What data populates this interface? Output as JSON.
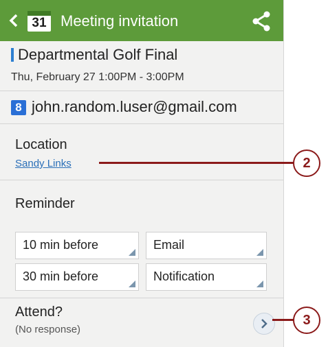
{
  "app_bar": {
    "calendar_day": "31",
    "title": "Meeting invitation"
  },
  "event": {
    "title": "Departmental Golf Final",
    "time": "Thu, February 27 1:00PM - 3:00PM"
  },
  "account": {
    "icon_label": "8",
    "email": "john.random.luser@gmail.com"
  },
  "location": {
    "label": "Location",
    "value": "Sandy Links"
  },
  "reminder": {
    "label": "Reminder",
    "rows": [
      {
        "time": "10 min before",
        "method": "Email"
      },
      {
        "time": "30 min before",
        "method": "Notification"
      }
    ]
  },
  "attend": {
    "label": "Attend?",
    "status": "(No response)"
  },
  "callouts": [
    "2",
    "3"
  ],
  "colors": {
    "app_bar": "#5d9b3a",
    "link": "#2a6fb8",
    "callout": "#8b1a1a",
    "title_accent": "#2d7fd1"
  },
  "icons": [
    "back-arrow-icon",
    "calendar-icon",
    "share-icon",
    "google-plus-icon",
    "chevron-right-icon"
  ]
}
